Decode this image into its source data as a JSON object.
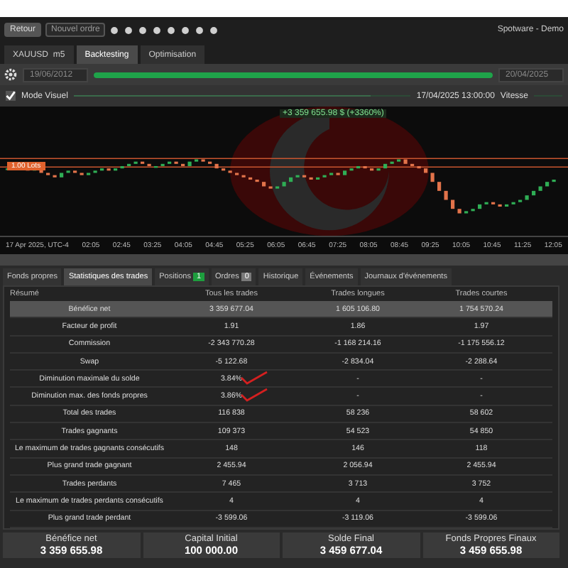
{
  "toolbar": {
    "back": "Retour",
    "new_order": "Nouvel ordre",
    "account": "Spotware - Demo"
  },
  "tabs": [
    {
      "label": "XAUUSD",
      "sub": "m5",
      "selected": false
    },
    {
      "label": "Backtesting",
      "selected": true
    },
    {
      "label": "Optimisation",
      "selected": false
    }
  ],
  "range": {
    "start": "19/06/2012",
    "end": "20/04/2025",
    "level": 1
  },
  "visual_mode": {
    "label": "Mode Visuel",
    "checked": true
  },
  "playback": {
    "time": "17/04/2025 13:00:00",
    "speed_label": "Vitesse",
    "level": 0.88
  },
  "chart": {
    "result": "+3 359 655.98 $ (+3360%)",
    "lot_label": "1.00 Lots",
    "axis_start": "17 Apr 2025, UTC-4",
    "times": [
      "02:05",
      "02:45",
      "03:25",
      "04:05",
      "04:45",
      "05:25",
      "06:05",
      "06:45",
      "07:25",
      "08:05",
      "08:45",
      "09:25",
      "10:05",
      "10:45",
      "11:25",
      "12:05"
    ]
  },
  "bottom_tabs": [
    {
      "label": "Fonds propres",
      "selected": false
    },
    {
      "label": "Statistiques des trades",
      "selected": true
    },
    {
      "label": "Positions",
      "badge": "1",
      "color": "#1e9e3e",
      "selected": false
    },
    {
      "label": "Ordres",
      "badge": "0",
      "color": "#7a7a7a",
      "selected": false
    },
    {
      "label": "Historique",
      "selected": false
    },
    {
      "label": "Événements",
      "selected": false
    },
    {
      "label": "Journaux d'événements",
      "selected": false
    }
  ],
  "table": {
    "columns": [
      "Résumé",
      "Tous les trades",
      "Trades longues",
      "Trades courtes"
    ],
    "rows": [
      {
        "cells": [
          "Bénéfice net",
          "3 359 677.04",
          "1 605 106.80",
          "1 754 570.24"
        ],
        "selected": true,
        "checkmark": false
      },
      {
        "cells": [
          "Facteur de profit",
          "1.91",
          "1.86",
          "1.97"
        ],
        "selected": false,
        "checkmark": false
      },
      {
        "cells": [
          "Commission",
          "-2 343 770.28",
          "-1 168 214.16",
          "-1 175 556.12"
        ],
        "selected": false,
        "checkmark": false
      },
      {
        "cells": [
          "Swap",
          "-5 122.68",
          "-2 834.04",
          "-2 288.64"
        ],
        "selected": false,
        "checkmark": false
      },
      {
        "cells": [
          "Diminution maximale du solde",
          "3.84%",
          "-",
          "-"
        ],
        "selected": false,
        "checkmark": true
      },
      {
        "cells": [
          "Diminution max. des fonds propres",
          "3.86%",
          "-",
          "-"
        ],
        "selected": false,
        "checkmark": true
      },
      {
        "cells": [
          "Total des trades",
          "116 838",
          "58 236",
          "58 602"
        ],
        "selected": false,
        "checkmark": false
      },
      {
        "cells": [
          "Trades gagnants",
          "109 373",
          "54 523",
          "54 850"
        ],
        "selected": false,
        "checkmark": false
      },
      {
        "cells": [
          "Le maximum de trades gagnants consécutifs",
          "148",
          "146",
          "118"
        ],
        "selected": false,
        "checkmark": false
      },
      {
        "cells": [
          "Plus grand trade gagnant",
          "2 455.94",
          "2 056.94",
          "2 455.94"
        ],
        "selected": false,
        "checkmark": false
      },
      {
        "cells": [
          "Trades perdants",
          "7 465",
          "3 713",
          "3 752"
        ],
        "selected": false,
        "checkmark": false
      },
      {
        "cells": [
          "Le maximum de trades perdants consécutifs",
          "4",
          "4",
          "4"
        ],
        "selected": false,
        "checkmark": false
      },
      {
        "cells": [
          "Plus grand trade perdant",
          "-3 599.06",
          "-3 119.06",
          "-3 599.06"
        ],
        "selected": false,
        "checkmark": false
      }
    ]
  },
  "summary": [
    {
      "label": "Bénéfice net",
      "value": "3 359 655.98"
    },
    {
      "label": "Capital Initial",
      "value": "100 000.00"
    },
    {
      "label": "Solde Final",
      "value": "3 459 677.04"
    },
    {
      "label": "Fonds Propres Finaux",
      "value": "3 459 655.98"
    }
  ]
}
